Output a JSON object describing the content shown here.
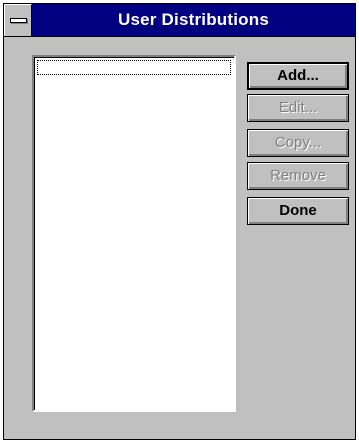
{
  "window": {
    "title": "User Distributions"
  },
  "list": {
    "items": []
  },
  "buttons": {
    "add": {
      "label": "Add...",
      "enabled": true
    },
    "edit": {
      "label": "Edit...",
      "enabled": false
    },
    "copy": {
      "label": "Copy...",
      "enabled": false
    },
    "remove": {
      "label": "Remove",
      "enabled": false
    },
    "done": {
      "label": "Done",
      "enabled": true
    }
  },
  "icons": {
    "system_menu": "system-menu-icon"
  },
  "colors": {
    "titlebar": "#000080",
    "face": "#c0c0c0",
    "disabled_text": "#808080"
  }
}
